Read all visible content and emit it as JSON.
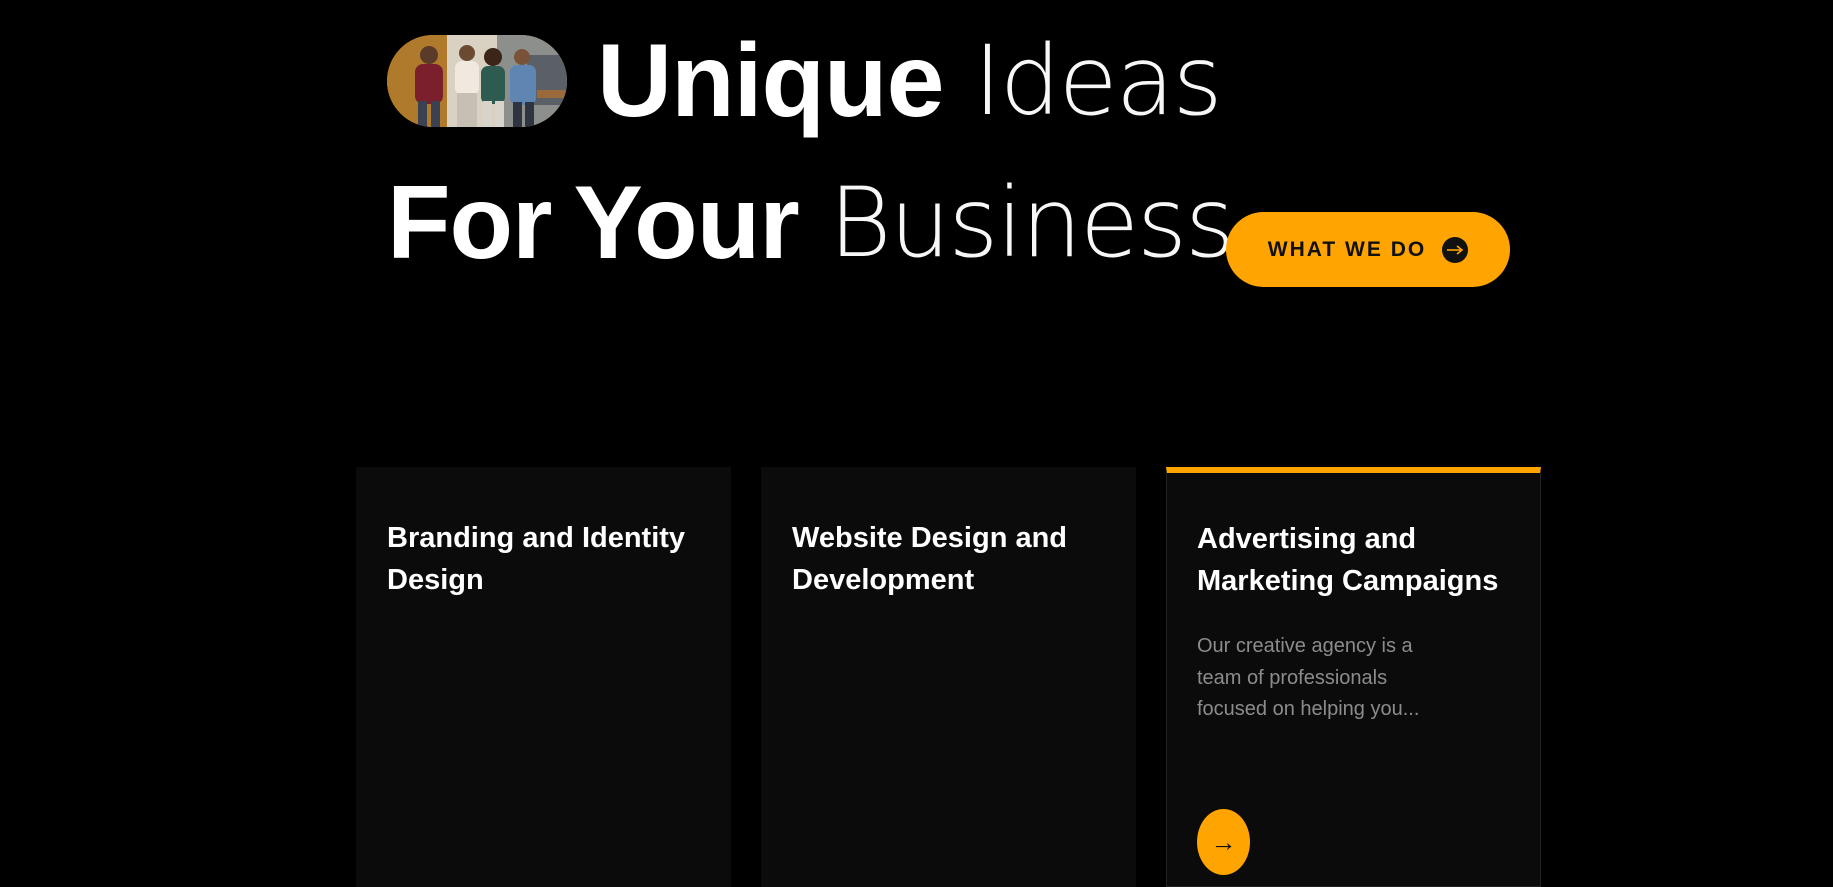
{
  "hero": {
    "line1": {
      "bold": "Unique",
      "light": "Ideas"
    },
    "line2": {
      "bold_a": "For",
      "bold_b": "Your",
      "light": "Business"
    },
    "photo_icon": "team-photo",
    "cta": {
      "label": "WHAT WE DO",
      "icon": "arrow-right-icon"
    }
  },
  "cards": [
    {
      "title": "Branding and Identity Design"
    },
    {
      "title": "Website Design and Development"
    },
    {
      "title": "Advertising and Marketing Campaigns",
      "description": "Our creative agency is a team of professionals focused on helping you...",
      "arrow": "→"
    }
  ],
  "colors": {
    "background": "#000000",
    "accent": "#ffa400",
    "card": "#0b0b0b",
    "muted_text": "#8c8c8c"
  }
}
